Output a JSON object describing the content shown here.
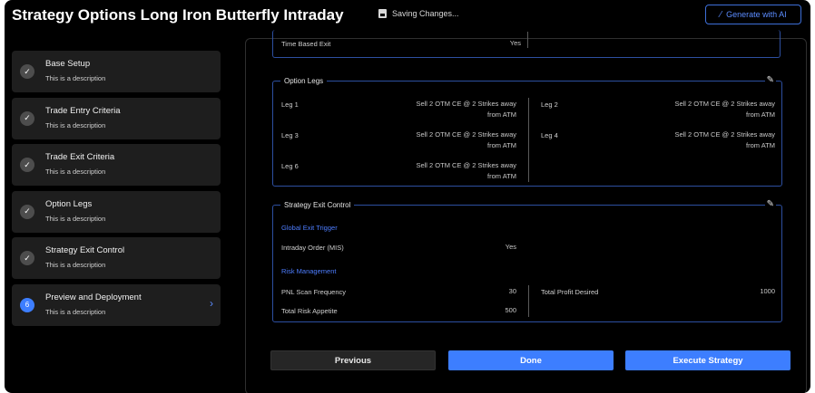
{
  "header": {
    "title": "Strategy Options Long Iron Butterfly Intraday",
    "saving_status": "Saving Changes...",
    "generate_label": "Generate with AI"
  },
  "steps": [
    {
      "label": "Base Setup",
      "desc": "This is a description",
      "badge": "✓"
    },
    {
      "label": "Trade Entry Criteria",
      "desc": "This is a description",
      "badge": "✓"
    },
    {
      "label": "Trade Exit Criteria",
      "desc": "This is a description",
      "badge": "✓"
    },
    {
      "label": "Option Legs",
      "desc": "This is a description",
      "badge": "✓"
    },
    {
      "label": "Strategy Exit Control",
      "desc": "This is a description",
      "badge": "✓"
    },
    {
      "label": "Preview and Deployment",
      "desc": "This is a description",
      "badge": "6"
    }
  ],
  "top_row": {
    "label": "Time Based Exit",
    "value": "Yes"
  },
  "option_legs": {
    "title": "Option Legs",
    "legs": [
      {
        "label": "Leg 1",
        "value_l1": "Sell 2 OTM CE @ 2 Strikes away",
        "value_l2": "from ATM"
      },
      {
        "label": "Leg 2",
        "value_l1": "Sell 2 OTM CE @ 2 Strikes away",
        "value_l2": "from ATM"
      },
      {
        "label": "Leg 3",
        "value_l1": "Sell 2 OTM CE @ 2 Strikes away",
        "value_l2": "from ATM"
      },
      {
        "label": "Leg 4",
        "value_l1": "Sell 2 OTM CE @ 2 Strikes away",
        "value_l2": "from ATM"
      },
      {
        "label": "Leg 6",
        "value_l1": "Sell 2 OTM CE @ 2 Strikes away",
        "value_l2": "from ATM"
      }
    ]
  },
  "exit_control": {
    "title": "Strategy Exit Control",
    "global_heading": "Global Exit Trigger",
    "intraday_label": "Intraday Order (MIS)",
    "intraday_value": "Yes",
    "risk_heading": "Risk Management",
    "pnl_label": "PNL Scan Frequency",
    "pnl_value": "30",
    "profit_label": "Total Profit Desired",
    "profit_value": "1000",
    "risk_label": "Total Risk Appetite",
    "risk_value": "500"
  },
  "footer": {
    "previous": "Previous",
    "done": "Done",
    "execute": "Execute Strategy"
  },
  "colors": {
    "accent": "#3d7eff",
    "border": "#2d4fa0",
    "background": "#000000"
  }
}
